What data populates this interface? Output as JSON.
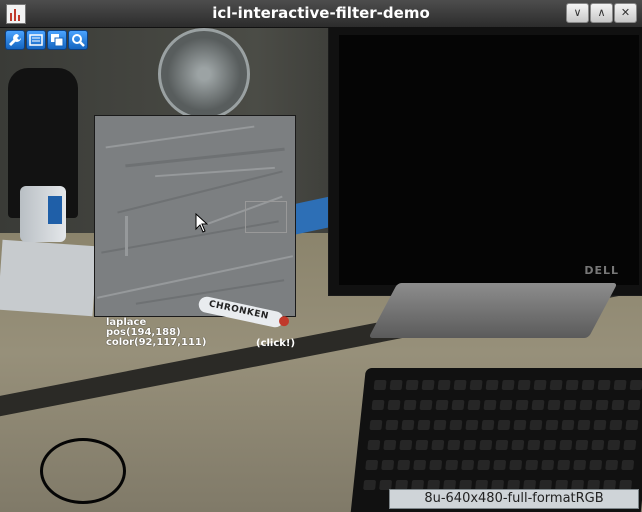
{
  "window": {
    "title": "icl-interactive-filter-demo",
    "icon": "app-icon",
    "controls": [
      "minimize-icon",
      "maximize-icon",
      "close-icon"
    ]
  },
  "toolbar": {
    "buttons": [
      {
        "icon": "wrench-icon"
      },
      {
        "icon": "display-icon"
      },
      {
        "icon": "layers-icon"
      },
      {
        "icon": "zoom-icon"
      }
    ]
  },
  "overlay": {
    "filter_name": "laplace",
    "pos": "pos(194,188)",
    "color": "color(92,117,111)",
    "click_hint": "(click!)"
  },
  "scene": {
    "marker_text": "CHRONKEN",
    "monitor_brand": "DELL"
  },
  "status": {
    "format": "8u-640x480-full-formatRGB"
  },
  "colors": {
    "toolbar_button": "#1e88e5",
    "titlebar": "#3a3a3a",
    "status_bar": "#cfd4d8"
  }
}
